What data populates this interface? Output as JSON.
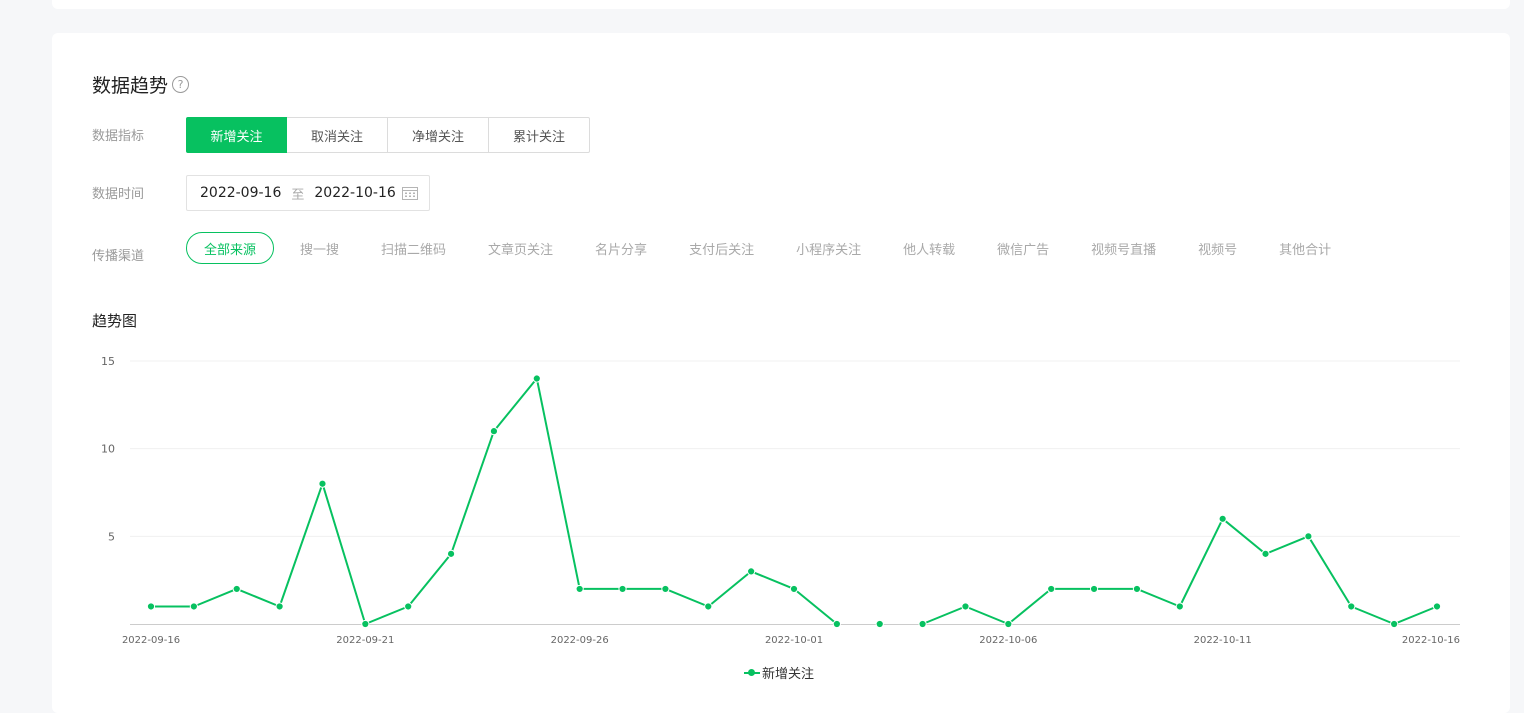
{
  "section": {
    "title": "数据趋势",
    "help_icon": "question-circle-icon"
  },
  "metric": {
    "label": "数据指标",
    "options": [
      "新增关注",
      "取消关注",
      "净增关注",
      "累计关注"
    ],
    "selected": "新增关注"
  },
  "time": {
    "label": "数据时间",
    "start": "2022-09-16",
    "separator": "至",
    "end": "2022-10-16",
    "icon": "calendar-icon"
  },
  "channel": {
    "label": "传播渠道",
    "options": [
      "全部来源",
      "搜一搜",
      "扫描二维码",
      "文章页关注",
      "名片分享",
      "支付后关注",
      "小程序关注",
      "他人转载",
      "微信广告",
      "视频号直播",
      "视频号",
      "其他合计"
    ],
    "selected": "全部来源"
  },
  "chart_title": "趋势图",
  "colors": {
    "accent": "#07c160",
    "axis": "#cccccc",
    "grid": "#f0f0f0"
  },
  "chart_data": {
    "type": "line",
    "ylim": [
      0,
      15
    ],
    "yticks": [
      5,
      10,
      15
    ],
    "x_tick_labels": [
      "2022-09-16",
      "2022-09-21",
      "2022-09-26",
      "2022-10-01",
      "2022-10-06",
      "2022-10-11",
      "2022-10-16"
    ],
    "x_tick_indices": [
      0,
      5,
      10,
      15,
      20,
      25,
      30
    ],
    "x": [
      "2022-09-16",
      "2022-09-17",
      "2022-09-18",
      "2022-09-19",
      "2022-09-20",
      "2022-09-21",
      "2022-09-22",
      "2022-09-23",
      "2022-09-24",
      "2022-09-25",
      "2022-09-26",
      "2022-09-27",
      "2022-09-28",
      "2022-09-29",
      "2022-09-30",
      "2022-10-01",
      "2022-10-02",
      "2022-10-03",
      "2022-10-04",
      "2022-10-05",
      "2022-10-06",
      "2022-10-07",
      "2022-10-08",
      "2022-10-09",
      "2022-10-10",
      "2022-10-11",
      "2022-10-12",
      "2022-10-13",
      "2022-10-14",
      "2022-10-15",
      "2022-10-16"
    ],
    "series": [
      {
        "name": "新增关注",
        "values": [
          1,
          1,
          2,
          1,
          8,
          0,
          1,
          4,
          11,
          14,
          2,
          2,
          2,
          1,
          3,
          2,
          0,
          0,
          0,
          1,
          0,
          2,
          2,
          2,
          1,
          6,
          4,
          5,
          1,
          0,
          1
        ],
        "line_gaps_after": [
          16,
          17
        ]
      }
    ],
    "legend": [
      "新增关注"
    ],
    "legend_position": "bottom-center",
    "grid": true
  }
}
